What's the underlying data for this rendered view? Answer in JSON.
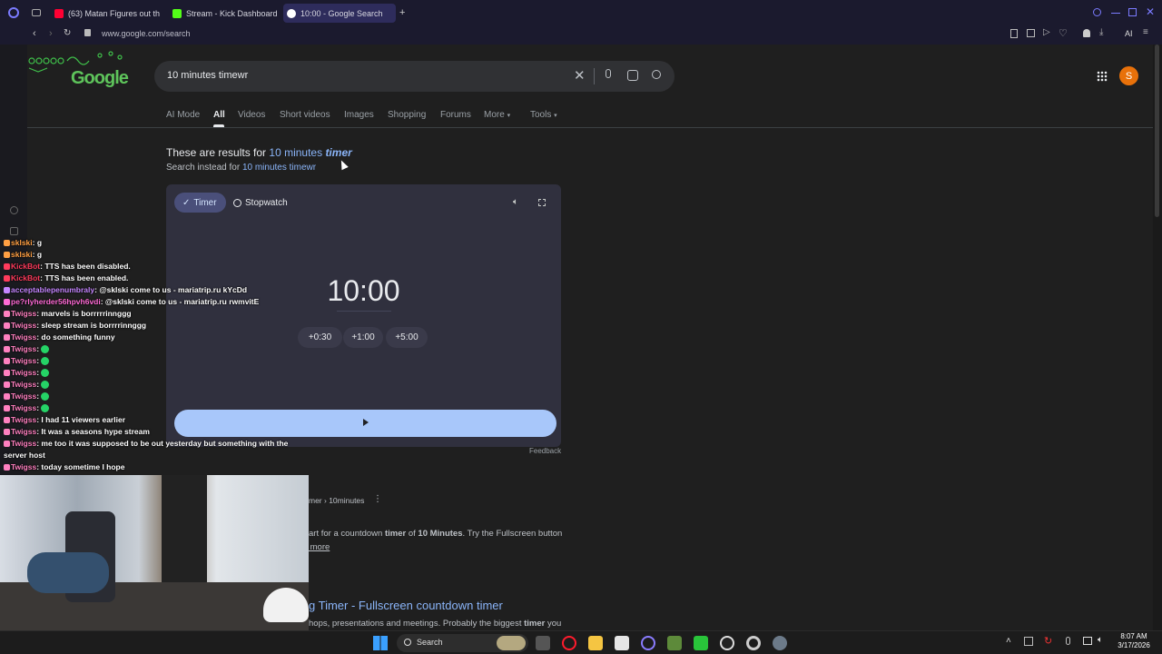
{
  "tabs": [
    {
      "label": "(63) Matan Figures out the",
      "color": "#ff0033"
    },
    {
      "label": "Stream - Kick Dashboard",
      "color": "#53fc18"
    },
    {
      "label": "10:00 - Google Search",
      "color": "#4285f4"
    }
  ],
  "address": {
    "url": "www.google.com/search"
  },
  "toolbar": {
    "ai_label": "AI"
  },
  "google": {
    "logo": "Google",
    "query": "10 minutes timewr",
    "account_initial": "S",
    "nav": [
      "AI Mode",
      "All",
      "Videos",
      "Short videos",
      "Images",
      "Shopping",
      "Forums",
      "More",
      "Tools"
    ],
    "corrected_prefix": "These are results for ",
    "corrected_query_plain": "10 minutes ",
    "corrected_query_bold": "timer",
    "instead_prefix": "Search instead for ",
    "instead_query": "10 minutes timewr"
  },
  "timer": {
    "tab_timer": "Timer",
    "tab_stopwatch": "Stopwatch",
    "display": "10:00",
    "increments": [
      "+0:30",
      "+1:00",
      "+5:00"
    ],
    "feedback": "Feedback"
  },
  "result1": {
    "breadcrumb": "mer › 10minutes",
    "snippet_pre": "art for a countdown ",
    "snippet_b1": "timer",
    "snippet_mid": " of ",
    "snippet_b2": "10 Minutes",
    "snippet_post": ". Try the Fullscreen button",
    "more": " more"
  },
  "result2": {
    "title": "g Timer - Fullscreen countdown timer",
    "snippet_pre": "hops, presentations and meetings. Probably the biggest ",
    "snippet_b": "timer",
    "snippet_post": " you"
  },
  "chat": [
    {
      "user": "sklski",
      "msg": ": g",
      "color": "#ff9f43"
    },
    {
      "user": "sklski",
      "msg": ": g",
      "color": "#ff9f43"
    },
    {
      "user": "KickBot",
      "msg": ": TTS has been disabled.",
      "color": "#ff3b5c"
    },
    {
      "user": "KickBot",
      "msg": ": TTS has been enabled.",
      "color": "#ff3b5c"
    },
    {
      "user": "acceptablepenumbraly",
      "msg": ": @sklski come to us - mariatrip.ru kYcDd",
      "color": "#c586ff"
    },
    {
      "user": "pe?rlyherder56hpvh6vdi",
      "msg": ": @sklski come to us - mariatrip.ru rwmvitE",
      "color": "#ff6bd6"
    },
    {
      "user": "Twigss",
      "msg": ": marvels is borrrrrinnggg",
      "color": "#ff80c0"
    },
    {
      "user": "Twigss",
      "msg": ": sleep stream is borrrrinnggg",
      "color": "#ff80c0"
    },
    {
      "user": "Twigss",
      "msg": ": do something funny",
      "color": "#ff80c0"
    },
    {
      "user": "Twigss",
      "msg": ": ",
      "color": "#ff80c0"
    },
    {
      "user": "Twigss",
      "msg": ": ",
      "color": "#ff80c0"
    },
    {
      "user": "Twigss",
      "msg": ": ",
      "color": "#ff80c0"
    },
    {
      "user": "Twigss",
      "msg": ": ",
      "color": "#ff80c0"
    },
    {
      "user": "Twigss",
      "msg": ": ",
      "color": "#ff80c0"
    },
    {
      "user": "Twigss",
      "msg": ": ",
      "color": "#ff80c0"
    },
    {
      "user": "Twigss",
      "msg": ": I had 11 viewers earlier",
      "color": "#ff80c0"
    },
    {
      "user": "Twigss",
      "msg": ": It was a seasons hype stream",
      "color": "#ff80c0"
    },
    {
      "user": "Twigss",
      "msg": ": me too it was supposed to be out yesterday but something with the",
      "color": "#ff80c0"
    },
    {
      "user": "",
      "msg": "server host",
      "color": "#ffffff"
    },
    {
      "user": "Twigss",
      "msg": ": today sometime I hope",
      "color": "#ff80c0"
    }
  ],
  "taskbar": {
    "search_label": "Search",
    "time": "8:07 AM",
    "date": "3/17/2026"
  },
  "colors": {
    "accent_blue": "#8ab4f8",
    "play_bar": "#a8c7fa",
    "timer_card": "#30303e"
  }
}
